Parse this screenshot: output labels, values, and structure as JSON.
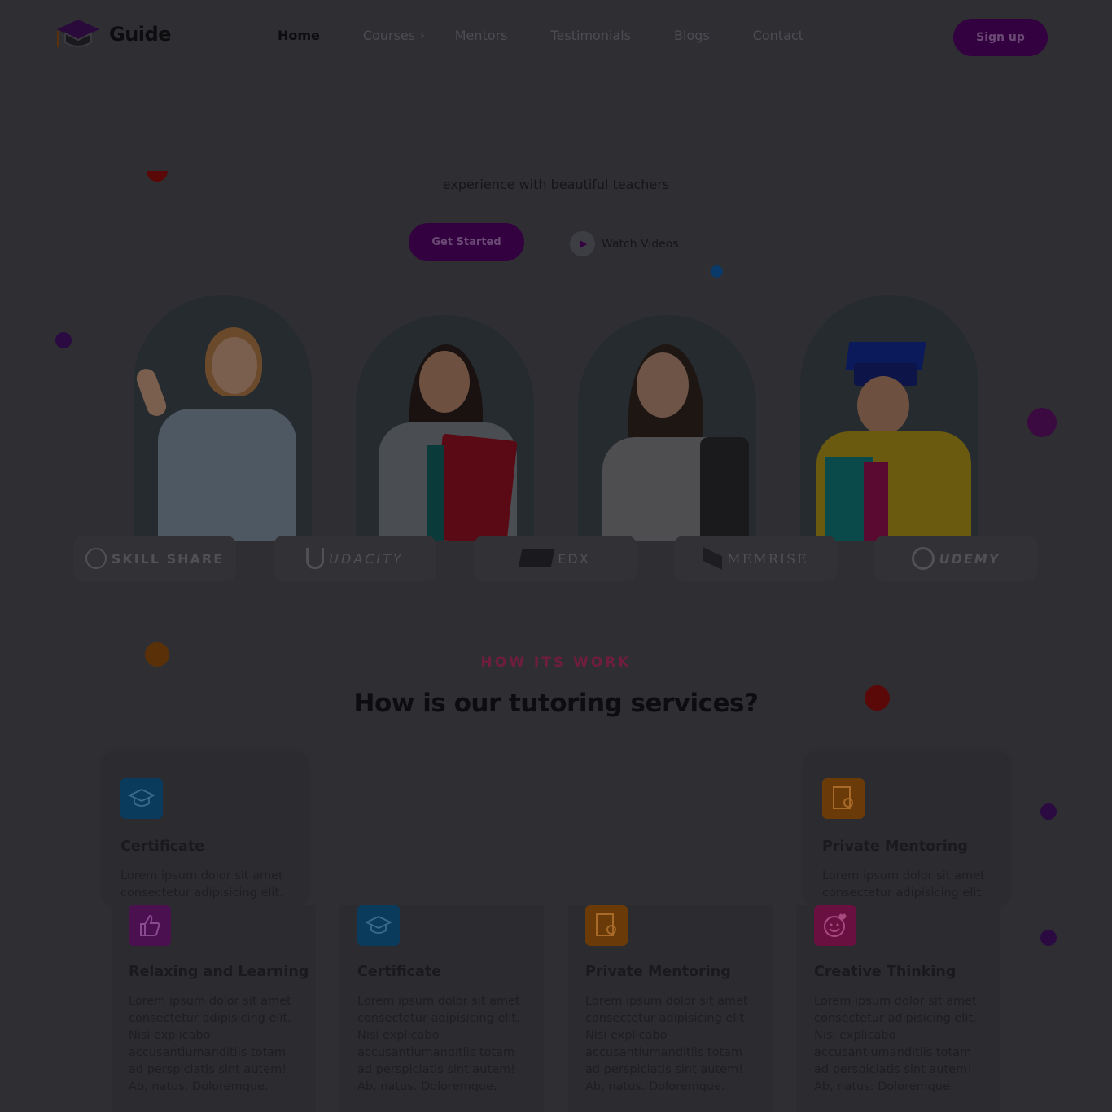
{
  "nav": {
    "brand": "Guide",
    "links": [
      "Home",
      "Courses",
      "Mentors",
      "Testimonials",
      "Blogs",
      "Contact"
    ],
    "signup_label": "Sign up"
  },
  "hero": {
    "subtitle": "experience with beautiful teachers",
    "get_started_label": "Get Started",
    "watch_label": "Watch Videos"
  },
  "partners": [
    "SKILL SHARE",
    "UDACITY",
    "EDX",
    "MEMRISE",
    "UDEMY"
  ],
  "how": {
    "tag": "HOW ITS WORK",
    "title": "How is our tutoring services?"
  },
  "cards_top": [
    {
      "title": "Certificate",
      "text": "Lorem ipsum dolor sit amet consectetur adipisicing elit.",
      "icon": "graduation-cap-icon",
      "color": "#0a3a5c"
    },
    {
      "title": "Private Mentoring",
      "text": "Lorem ipsum dolor sit amet consectetur adipisicing elit.",
      "icon": "certificate-award-icon",
      "color": "#6a3a08"
    }
  ],
  "cards_bottom": [
    {
      "title": "Relaxing and Learning",
      "text": "Lorem ipsum dolor sit amet consectetur adipisicing elit. Nisi explicabo accusantiumanditiis totam ad perspiciatis sint autem! Ab, natus. Doloremque.",
      "icon": "thumbs-up-icon",
      "color": "#4a1050"
    },
    {
      "title": "Certificate",
      "text": "Lorem ipsum dolor sit amet consectetur adipisicing elit. Nisi explicabo accusantiumanditiis totam ad perspiciatis sint autem! Ab, natus. Doloremque.",
      "icon": "graduation-cap-icon",
      "color": "#0a3a5c"
    },
    {
      "title": "Private Mentoring",
      "text": "Lorem ipsum dolor sit amet consectetur adipisicing elit. Nisi explicabo accusantiumanditiis totam ad perspiciatis sint autem! Ab, natus. Doloremque.",
      "icon": "certificate-award-icon",
      "color": "#6a3a08"
    },
    {
      "title": "Creative Thinking",
      "text": "Lorem ipsum dolor sit amet consectetur adipisicing elit. Nisi explicabo accusantiumanditiis totam ad perspiciatis sint autem! Ab, natus. Doloremque.",
      "icon": "smiley-heart-icon",
      "color": "#6a1040"
    }
  ],
  "colors": {
    "brand_purple": "#330040",
    "overlay_bg": "#2f2f33",
    "tag_pink": "#6e1d3d"
  }
}
